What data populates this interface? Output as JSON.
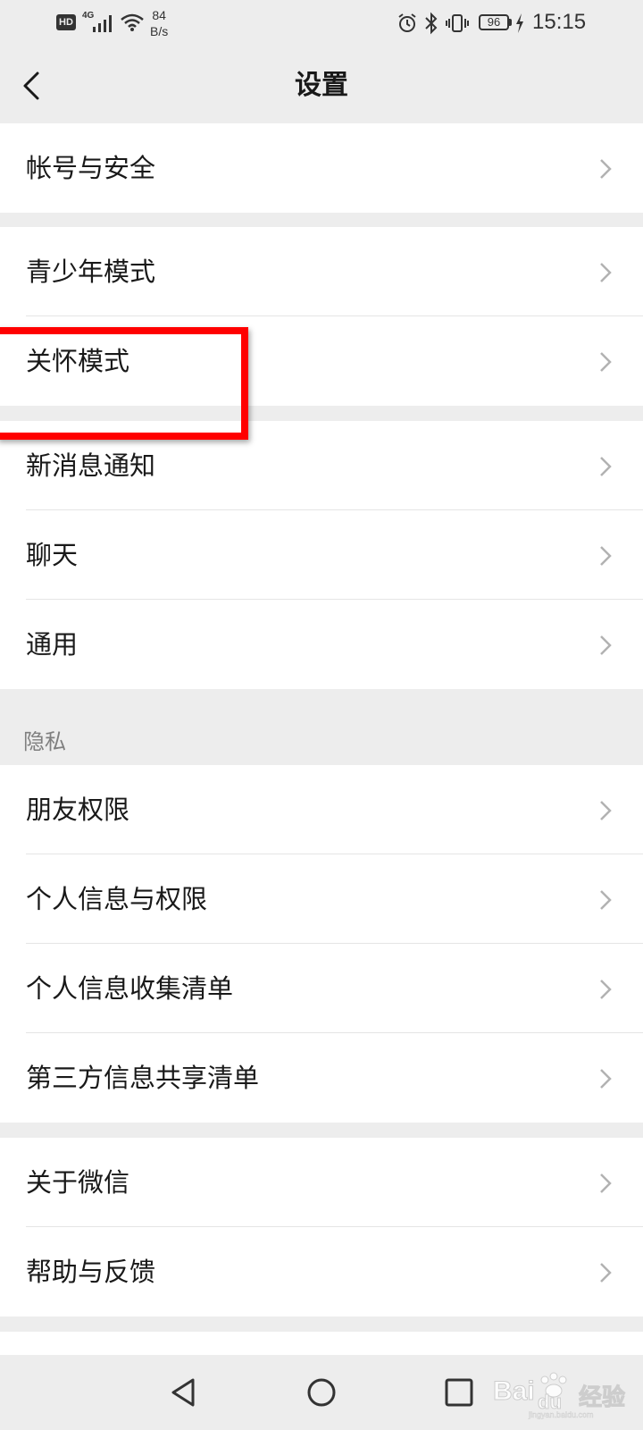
{
  "status_bar": {
    "hd": "HD",
    "network": "4G",
    "speed_value": "84",
    "speed_unit": "B/s",
    "battery": "96",
    "time": "15:15"
  },
  "nav": {
    "title": "设置"
  },
  "groups": [
    {
      "items": [
        {
          "label": "帐号与安全"
        }
      ]
    },
    {
      "items": [
        {
          "label": "青少年模式"
        },
        {
          "label": "关怀模式"
        }
      ]
    },
    {
      "items": [
        {
          "label": "新消息通知"
        },
        {
          "label": "聊天"
        },
        {
          "label": "通用"
        }
      ]
    },
    {
      "header": "隐私",
      "items": [
        {
          "label": "朋友权限"
        },
        {
          "label": "个人信息与权限"
        },
        {
          "label": "个人信息收集清单"
        },
        {
          "label": "第三方信息共享清单"
        }
      ]
    },
    {
      "items": [
        {
          "label": "关于微信"
        },
        {
          "label": "帮助与反馈"
        }
      ]
    }
  ],
  "watermark": {
    "brand": "Bai",
    "brand2": "du",
    "product": "经验",
    "domain": "jingyan.baidu.com"
  },
  "colors": {
    "background": "#ededed",
    "card": "#ffffff",
    "highlight": "#ff0000"
  }
}
